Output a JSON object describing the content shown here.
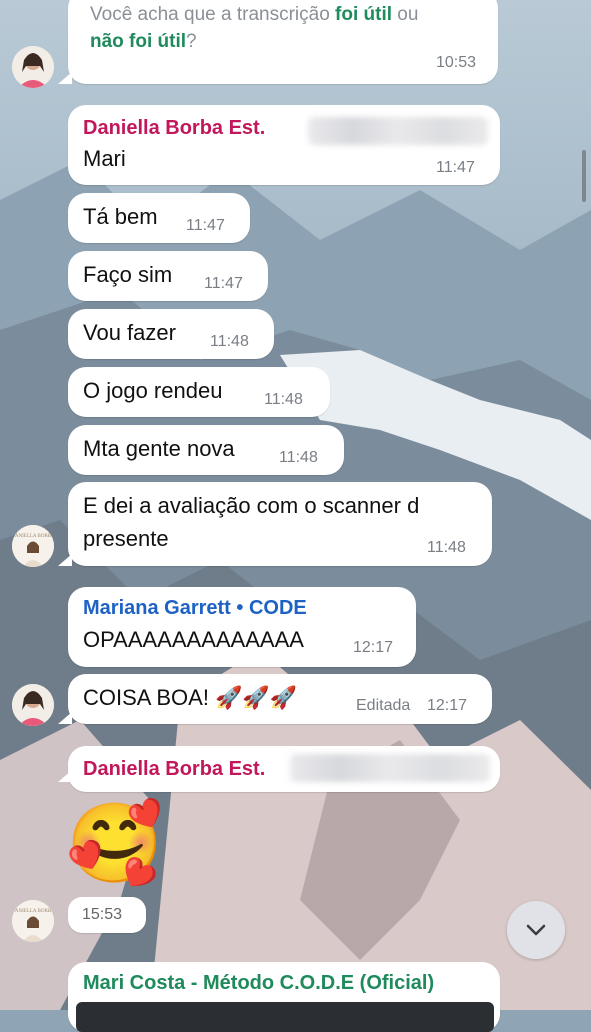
{
  "colors": {
    "link_green": "#1f8a5b",
    "sender_pink": "#c2185b",
    "sender_blue": "#1e62c4",
    "bubble": "#ffffff",
    "time": "#7a7f85"
  },
  "messages": [
    {
      "type": "poll_prompt",
      "text_prefix": "Você acha que a transcrição ",
      "link1": "foi útil",
      "text_mid": " ou",
      "link2": "não foi útil",
      "text_suffix": "?",
      "time": "10:53"
    },
    {
      "sender": "Daniella Borba Est.",
      "text": "Mari",
      "time": "11:47"
    },
    {
      "text": "Tá bem",
      "time": "11:47"
    },
    {
      "text": "Faço sim",
      "time": "11:47"
    },
    {
      "text": "Vou fazer",
      "time": "11:48"
    },
    {
      "text": "O jogo rendeu",
      "time": "11:48"
    },
    {
      "text": "Mta gente nova",
      "time": "11:48"
    },
    {
      "text_line1": "E dei a avaliação com o scanner d",
      "text_line2": "presente",
      "time": "11:48"
    },
    {
      "sender": "Mariana Garrett • CODE",
      "text": "OPAAAAAAAAAAAAA",
      "time": "12:17"
    },
    {
      "text": "COISA BOA! 🚀🚀🚀",
      "edited_label": "Editada",
      "time": "12:17"
    },
    {
      "sender": "Daniella Borba Est.",
      "emoji": "🥰",
      "time": "15:53"
    },
    {
      "sender": "Mari Costa - Método C.O.D.E (Oficial)"
    }
  ],
  "icons": {
    "scroll_down": "chevron-down-icon"
  }
}
